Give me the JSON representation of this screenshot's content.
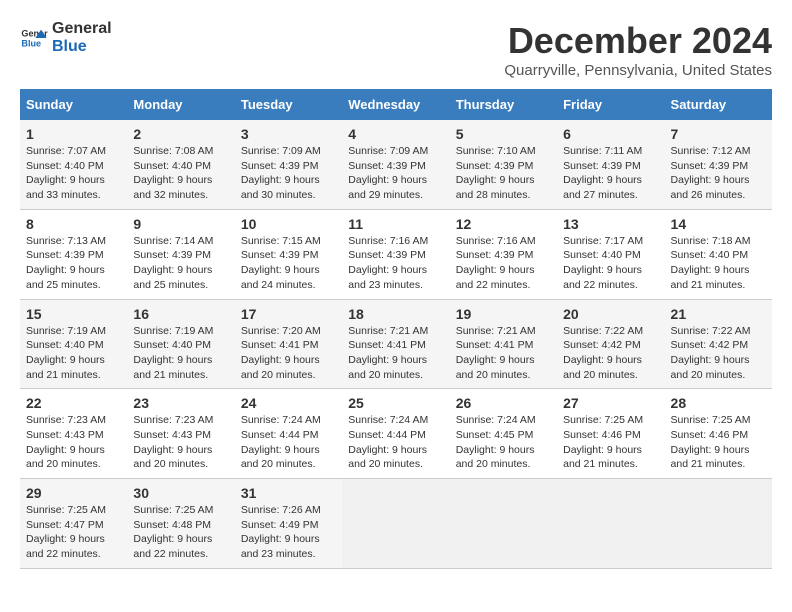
{
  "logo": {
    "text_general": "General",
    "text_blue": "Blue"
  },
  "header": {
    "month": "December 2024",
    "location": "Quarryville, Pennsylvania, United States"
  },
  "days_of_week": [
    "Sunday",
    "Monday",
    "Tuesday",
    "Wednesday",
    "Thursday",
    "Friday",
    "Saturday"
  ],
  "weeks": [
    [
      {
        "day": "1",
        "sunrise": "Sunrise: 7:07 AM",
        "sunset": "Sunset: 4:40 PM",
        "daylight": "Daylight: 9 hours and 33 minutes."
      },
      {
        "day": "2",
        "sunrise": "Sunrise: 7:08 AM",
        "sunset": "Sunset: 4:40 PM",
        "daylight": "Daylight: 9 hours and 32 minutes."
      },
      {
        "day": "3",
        "sunrise": "Sunrise: 7:09 AM",
        "sunset": "Sunset: 4:39 PM",
        "daylight": "Daylight: 9 hours and 30 minutes."
      },
      {
        "day": "4",
        "sunrise": "Sunrise: 7:09 AM",
        "sunset": "Sunset: 4:39 PM",
        "daylight": "Daylight: 9 hours and 29 minutes."
      },
      {
        "day": "5",
        "sunrise": "Sunrise: 7:10 AM",
        "sunset": "Sunset: 4:39 PM",
        "daylight": "Daylight: 9 hours and 28 minutes."
      },
      {
        "day": "6",
        "sunrise": "Sunrise: 7:11 AM",
        "sunset": "Sunset: 4:39 PM",
        "daylight": "Daylight: 9 hours and 27 minutes."
      },
      {
        "day": "7",
        "sunrise": "Sunrise: 7:12 AM",
        "sunset": "Sunset: 4:39 PM",
        "daylight": "Daylight: 9 hours and 26 minutes."
      }
    ],
    [
      {
        "day": "8",
        "sunrise": "Sunrise: 7:13 AM",
        "sunset": "Sunset: 4:39 PM",
        "daylight": "Daylight: 9 hours and 25 minutes."
      },
      {
        "day": "9",
        "sunrise": "Sunrise: 7:14 AM",
        "sunset": "Sunset: 4:39 PM",
        "daylight": "Daylight: 9 hours and 25 minutes."
      },
      {
        "day": "10",
        "sunrise": "Sunrise: 7:15 AM",
        "sunset": "Sunset: 4:39 PM",
        "daylight": "Daylight: 9 hours and 24 minutes."
      },
      {
        "day": "11",
        "sunrise": "Sunrise: 7:16 AM",
        "sunset": "Sunset: 4:39 PM",
        "daylight": "Daylight: 9 hours and 23 minutes."
      },
      {
        "day": "12",
        "sunrise": "Sunrise: 7:16 AM",
        "sunset": "Sunset: 4:39 PM",
        "daylight": "Daylight: 9 hours and 22 minutes."
      },
      {
        "day": "13",
        "sunrise": "Sunrise: 7:17 AM",
        "sunset": "Sunset: 4:40 PM",
        "daylight": "Daylight: 9 hours and 22 minutes."
      },
      {
        "day": "14",
        "sunrise": "Sunrise: 7:18 AM",
        "sunset": "Sunset: 4:40 PM",
        "daylight": "Daylight: 9 hours and 21 minutes."
      }
    ],
    [
      {
        "day": "15",
        "sunrise": "Sunrise: 7:19 AM",
        "sunset": "Sunset: 4:40 PM",
        "daylight": "Daylight: 9 hours and 21 minutes."
      },
      {
        "day": "16",
        "sunrise": "Sunrise: 7:19 AM",
        "sunset": "Sunset: 4:40 PM",
        "daylight": "Daylight: 9 hours and 21 minutes."
      },
      {
        "day": "17",
        "sunrise": "Sunrise: 7:20 AM",
        "sunset": "Sunset: 4:41 PM",
        "daylight": "Daylight: 9 hours and 20 minutes."
      },
      {
        "day": "18",
        "sunrise": "Sunrise: 7:21 AM",
        "sunset": "Sunset: 4:41 PM",
        "daylight": "Daylight: 9 hours and 20 minutes."
      },
      {
        "day": "19",
        "sunrise": "Sunrise: 7:21 AM",
        "sunset": "Sunset: 4:41 PM",
        "daylight": "Daylight: 9 hours and 20 minutes."
      },
      {
        "day": "20",
        "sunrise": "Sunrise: 7:22 AM",
        "sunset": "Sunset: 4:42 PM",
        "daylight": "Daylight: 9 hours and 20 minutes."
      },
      {
        "day": "21",
        "sunrise": "Sunrise: 7:22 AM",
        "sunset": "Sunset: 4:42 PM",
        "daylight": "Daylight: 9 hours and 20 minutes."
      }
    ],
    [
      {
        "day": "22",
        "sunrise": "Sunrise: 7:23 AM",
        "sunset": "Sunset: 4:43 PM",
        "daylight": "Daylight: 9 hours and 20 minutes."
      },
      {
        "day": "23",
        "sunrise": "Sunrise: 7:23 AM",
        "sunset": "Sunset: 4:43 PM",
        "daylight": "Daylight: 9 hours and 20 minutes."
      },
      {
        "day": "24",
        "sunrise": "Sunrise: 7:24 AM",
        "sunset": "Sunset: 4:44 PM",
        "daylight": "Daylight: 9 hours and 20 minutes."
      },
      {
        "day": "25",
        "sunrise": "Sunrise: 7:24 AM",
        "sunset": "Sunset: 4:44 PM",
        "daylight": "Daylight: 9 hours and 20 minutes."
      },
      {
        "day": "26",
        "sunrise": "Sunrise: 7:24 AM",
        "sunset": "Sunset: 4:45 PM",
        "daylight": "Daylight: 9 hours and 20 minutes."
      },
      {
        "day": "27",
        "sunrise": "Sunrise: 7:25 AM",
        "sunset": "Sunset: 4:46 PM",
        "daylight": "Daylight: 9 hours and 21 minutes."
      },
      {
        "day": "28",
        "sunrise": "Sunrise: 7:25 AM",
        "sunset": "Sunset: 4:46 PM",
        "daylight": "Daylight: 9 hours and 21 minutes."
      }
    ],
    [
      {
        "day": "29",
        "sunrise": "Sunrise: 7:25 AM",
        "sunset": "Sunset: 4:47 PM",
        "daylight": "Daylight: 9 hours and 22 minutes."
      },
      {
        "day": "30",
        "sunrise": "Sunrise: 7:25 AM",
        "sunset": "Sunset: 4:48 PM",
        "daylight": "Daylight: 9 hours and 22 minutes."
      },
      {
        "day": "31",
        "sunrise": "Sunrise: 7:26 AM",
        "sunset": "Sunset: 4:49 PM",
        "daylight": "Daylight: 9 hours and 23 minutes."
      },
      null,
      null,
      null,
      null
    ]
  ]
}
